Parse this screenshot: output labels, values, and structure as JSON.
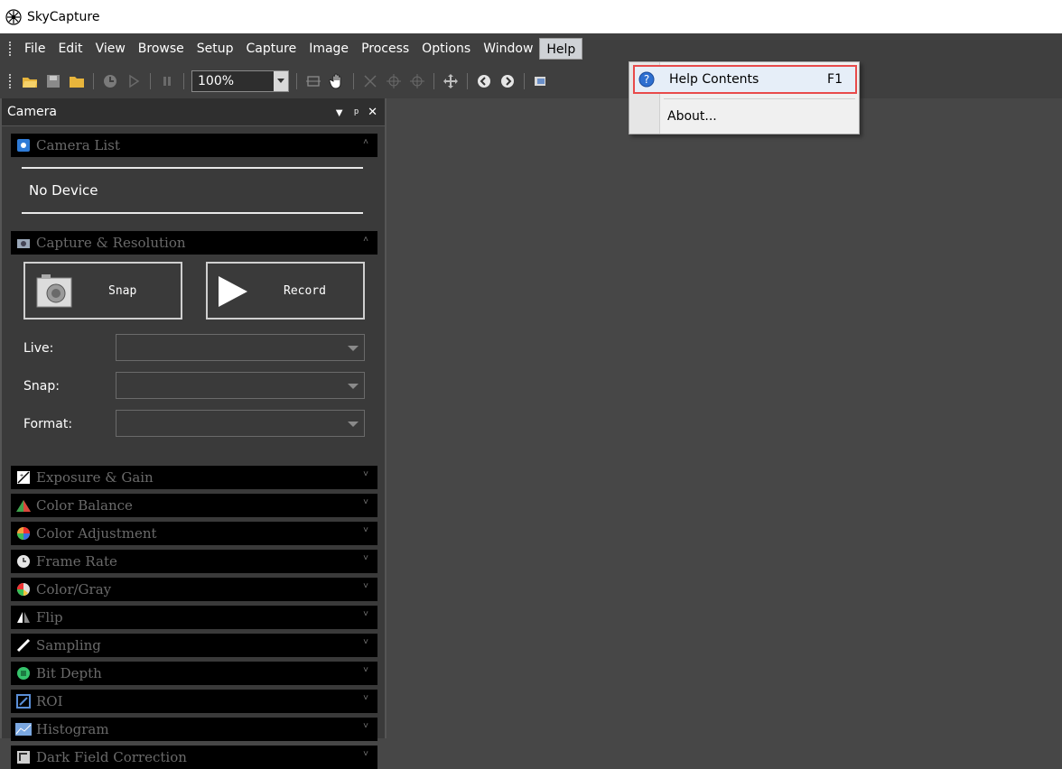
{
  "app": {
    "title": "SkyCapture"
  },
  "menubar": {
    "items": [
      "File",
      "Edit",
      "View",
      "Browse",
      "Setup",
      "Capture",
      "Image",
      "Process",
      "Options",
      "Window",
      "Help"
    ],
    "active": "Help"
  },
  "toolbar": {
    "zoom": "100%",
    "icons": [
      "open-folder-icon",
      "save-icon",
      "folder-icon",
      "timer-icon",
      "play-icon",
      "pause-icon",
      "zoom-combo",
      "rect-select-icon",
      "hand-icon",
      "cross-icon",
      "target-icon",
      "target2-icon",
      "move-icon",
      "prev-icon",
      "next-icon",
      "batch-icon"
    ]
  },
  "panel": {
    "title": "Camera",
    "camera_list": {
      "label": "Camera List",
      "status": "No Device"
    },
    "capture": {
      "label": "Capture & Resolution",
      "snap_label": "Snap",
      "record_label": "Record",
      "live_label": "Live:",
      "snap_res_label": "Snap:",
      "format_label": "Format:"
    },
    "sections": [
      {
        "label": "Exposure & Gain",
        "icon": "exposure-icon",
        "color": "#ffffff"
      },
      {
        "label": "Color Balance",
        "icon": "color-balance-icon",
        "color": "#3fa34d"
      },
      {
        "label": "Color Adjustment",
        "icon": "color-wheel-icon",
        "color": "#f2a03d"
      },
      {
        "label": "Frame Rate",
        "icon": "clock-icon",
        "color": "#ffffff"
      },
      {
        "label": "Color/Gray",
        "icon": "color-gray-icon",
        "color": "#e0e0e0"
      },
      {
        "label": "Flip",
        "icon": "flip-icon",
        "color": "#ffffff"
      },
      {
        "label": "Sampling",
        "icon": "sampling-icon",
        "color": "#ffffff"
      },
      {
        "label": "Bit Depth",
        "icon": "bit-depth-icon",
        "color": "#35c36b"
      },
      {
        "label": "ROI",
        "icon": "roi-icon",
        "color": "#5a8fd8"
      },
      {
        "label": "Histogram",
        "icon": "histogram-icon",
        "color": "#7aa7e0"
      },
      {
        "label": "Dark Field Correction",
        "icon": "dark-field-icon",
        "color": "#cfcfcf"
      }
    ]
  },
  "help_menu": {
    "items": [
      {
        "label": "Help Contents",
        "shortcut": "F1"
      },
      {
        "label": "About...",
        "shortcut": ""
      }
    ]
  }
}
